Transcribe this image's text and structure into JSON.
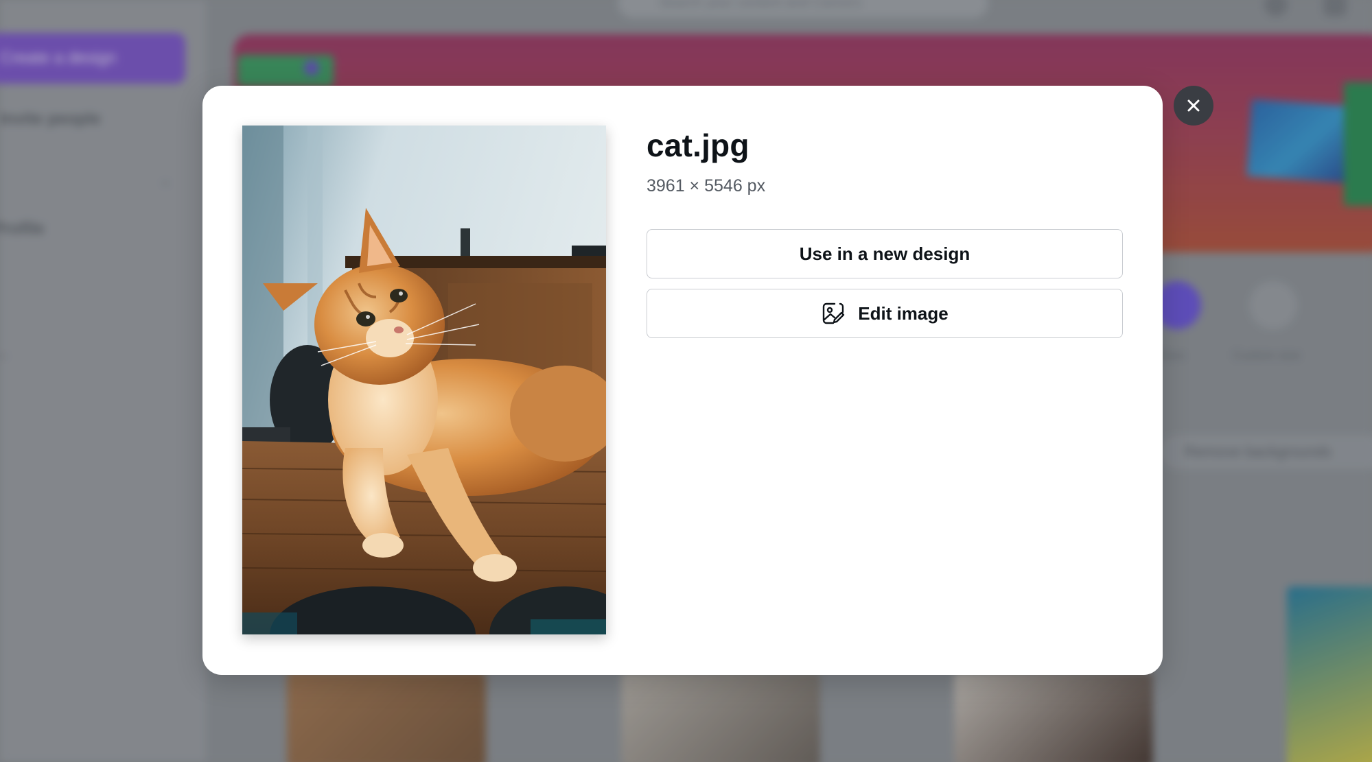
{
  "background": {
    "sidebar": {
      "create_button_label": "Create a design",
      "items": [
        "Invite people",
        "Profile"
      ]
    },
    "search_placeholder": "Search your content and Canva's",
    "quick_actions": [
      "Docs",
      "Custom size"
    ],
    "remove_background_label": "Remove backgrounds"
  },
  "modal": {
    "file_name": "cat.jpg",
    "dimensions": "3961 × 5546 px",
    "buttons": {
      "use_in_new_design": "Use in a new design",
      "edit_image": "Edit image"
    },
    "icons": {
      "edit_image": "image-edit-icon",
      "close": "close-icon"
    }
  },
  "colors": {
    "modal_background": "#ffffff",
    "close_button": "#3a3d43",
    "title_text": "#0e1318",
    "secondary_text": "#545a62",
    "button_border": "#c9ccd1",
    "brand_purple": "#7d58c9"
  }
}
